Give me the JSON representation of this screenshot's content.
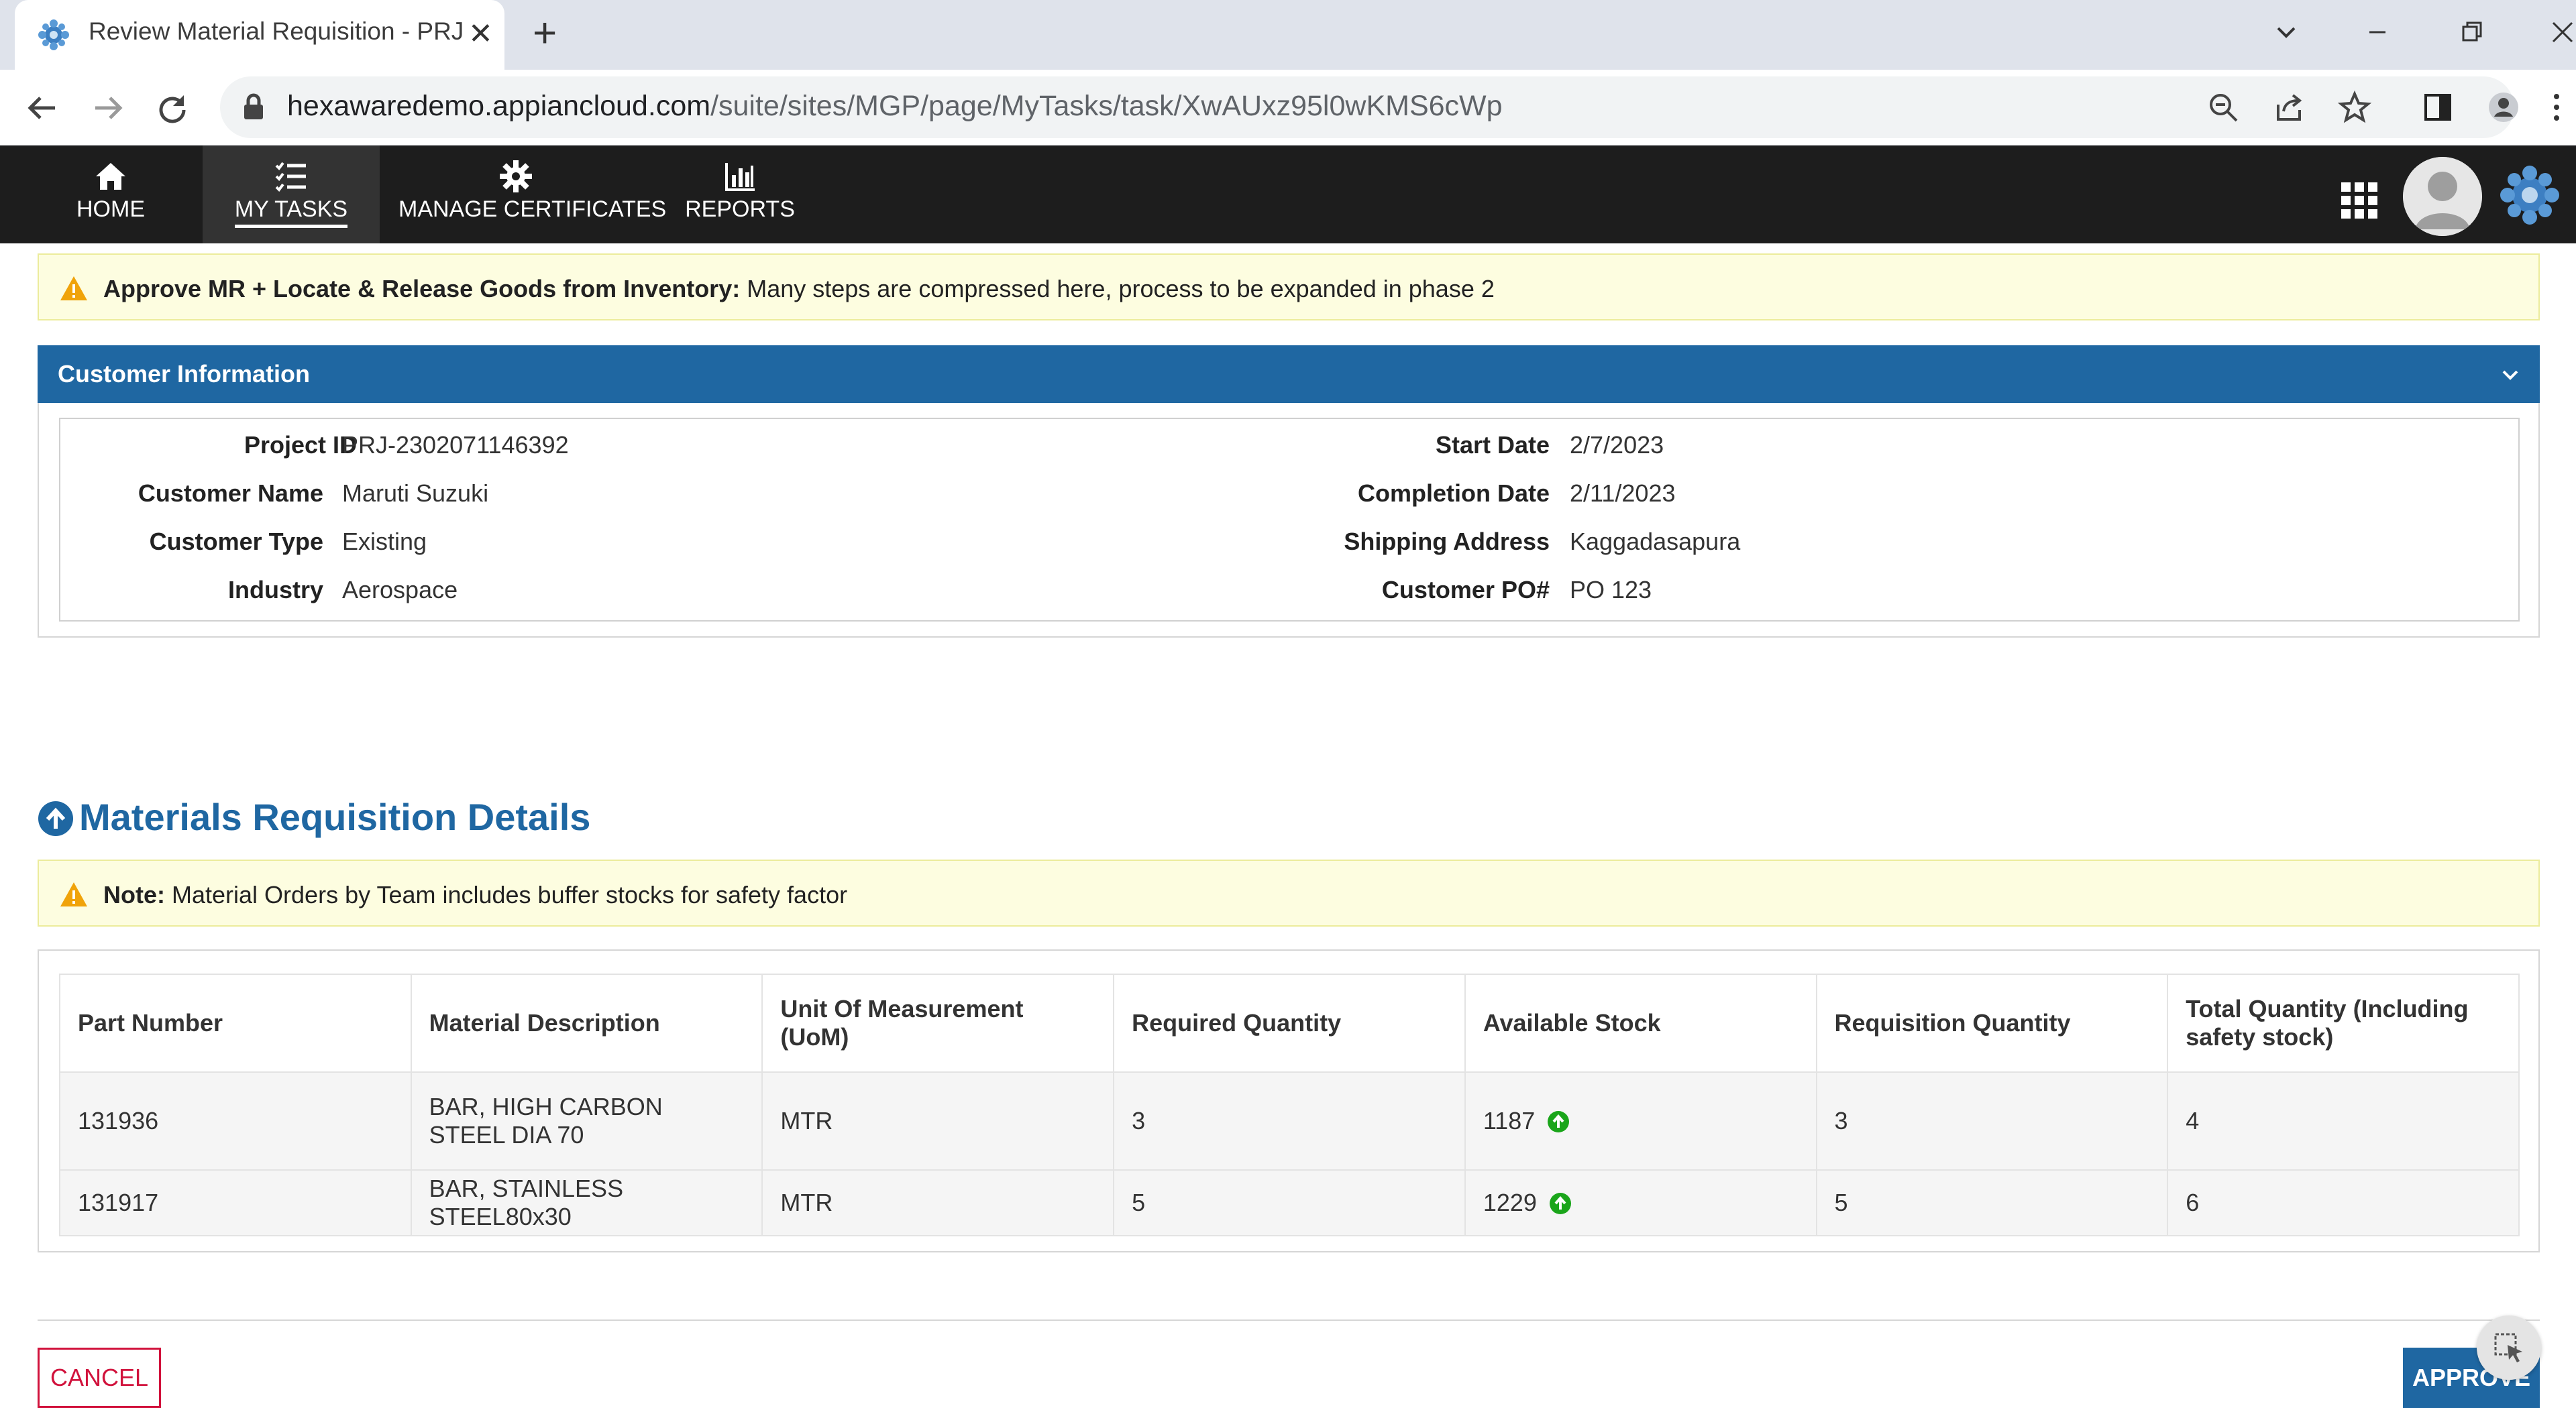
{
  "browser": {
    "tab_title": "Review Material Requisition - PRJ",
    "url_host": "hexawaredemo.appiancloud.com",
    "url_path": "/suite/sites/MGP/page/MyTasks/task/XwAUxz95l0wKMS6cWp"
  },
  "nav": {
    "items": [
      {
        "label": "HOME",
        "icon": "home-icon"
      },
      {
        "label": "MY TASKS",
        "icon": "tasks-icon",
        "active": true
      },
      {
        "label": "MANAGE CERTIFICATES",
        "icon": "gear-icon"
      },
      {
        "label": "REPORTS",
        "icon": "bar-chart-icon"
      }
    ]
  },
  "banner1": {
    "bold": "Approve MR + Locate & Release Goods from Inventory:",
    "text": " Many steps are compressed here, process to be expanded in phase 2"
  },
  "customer": {
    "title": "Customer Information",
    "left": [
      {
        "label": "Project ID",
        "value": "PRJ-2302071146392"
      },
      {
        "label": "Customer Name",
        "value": "Maruti Suzuki"
      },
      {
        "label": "Customer Type",
        "value": "Existing"
      },
      {
        "label": "Industry",
        "value": "Aerospace"
      }
    ],
    "right": [
      {
        "label": "Start Date",
        "value": "2/7/2023"
      },
      {
        "label": "Completion Date",
        "value": "2/11/2023"
      },
      {
        "label": "Shipping Address",
        "value": "Kaggadasapura"
      },
      {
        "label": "Customer PO#",
        "value": "PO 123"
      }
    ]
  },
  "materials": {
    "title": "Materials Requisition Details",
    "note_bold": "Note:",
    "note_text": " Material Orders by Team includes buffer stocks for safety factor",
    "columns": [
      "Part Number",
      "Material Description",
      "Unit Of Measurement (UoM)",
      "Required Quantity",
      "Available Stock",
      "Requisition Quantity",
      "Total Quantity (Including safety stock)"
    ],
    "rows": [
      [
        "131936",
        "BAR, HIGH CARBON STEEL DIA 70",
        "MTR",
        "3",
        "1187",
        "3",
        "4"
      ],
      [
        "131917",
        "BAR, STAINLESS STEEL80x30",
        "MTR",
        "5",
        "1229",
        "5",
        "6"
      ]
    ]
  },
  "actions": {
    "cancel": "CANCEL",
    "approve": "APPROVE"
  },
  "colors": {
    "primary": "#1f67a2",
    "nav_bg": "#1d1d1d",
    "warning_bg": "#fdfde0",
    "cancel": "#d1123c",
    "stock_ok": "#1aa51a"
  }
}
